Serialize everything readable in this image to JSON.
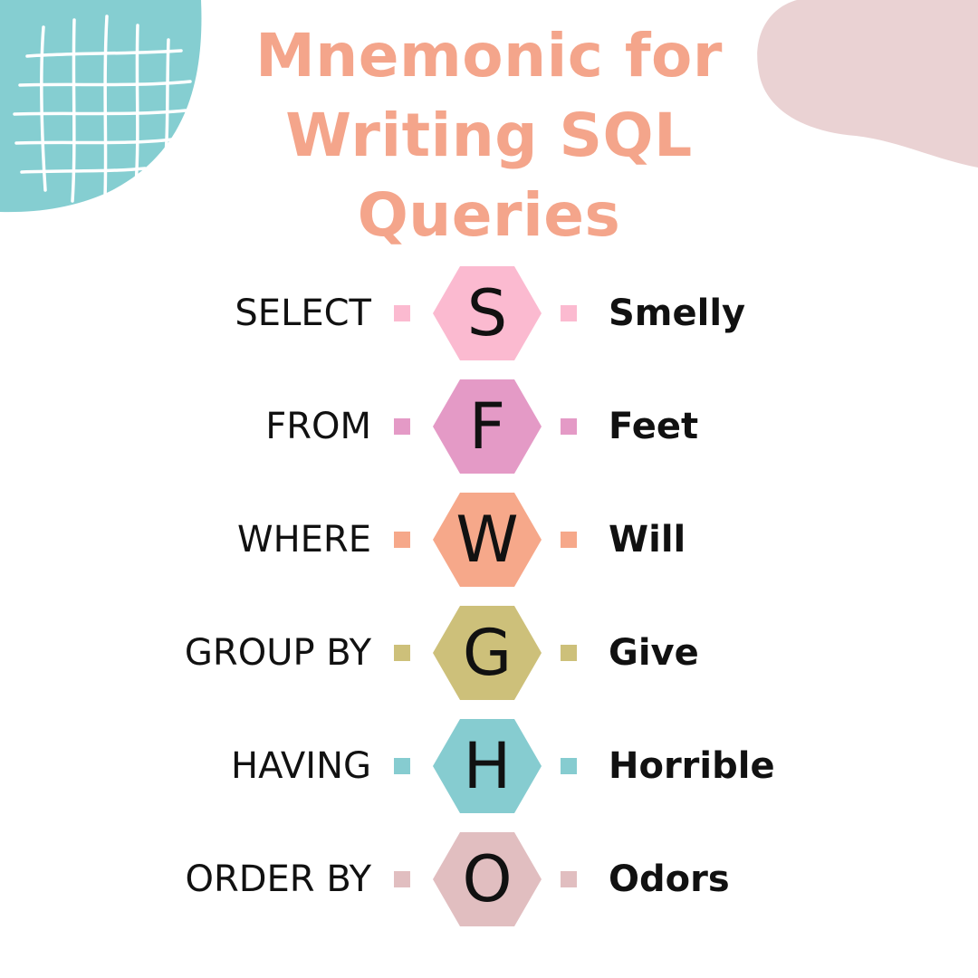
{
  "title": {
    "lines": [
      "Mnemonic for",
      "Writing SQL",
      "Queries"
    ],
    "color": "#f4a58b"
  },
  "decoration": {
    "corner_circle_color": "#85ced1",
    "corner_blob_color": "#ead2d3",
    "grid_color": "#ffffff"
  },
  "rows": [
    {
      "keyword": "SELECT",
      "letter": "S",
      "word": "Smelly",
      "color": "#fbbad0"
    },
    {
      "keyword": "FROM",
      "letter": "F",
      "word": "Feet",
      "color": "#e49ac6"
    },
    {
      "keyword": "WHERE",
      "letter": "W",
      "word": "Will",
      "color": "#f6a88a"
    },
    {
      "keyword": "GROUP BY",
      "letter": "G",
      "word": "Give",
      "color": "#cdc07a"
    },
    {
      "keyword": "HAVING",
      "letter": "H",
      "word": "Horrible",
      "color": "#86ccd0"
    },
    {
      "keyword": "ORDER BY",
      "letter": "O",
      "word": "Odors",
      "color": "#e1bec0"
    }
  ]
}
